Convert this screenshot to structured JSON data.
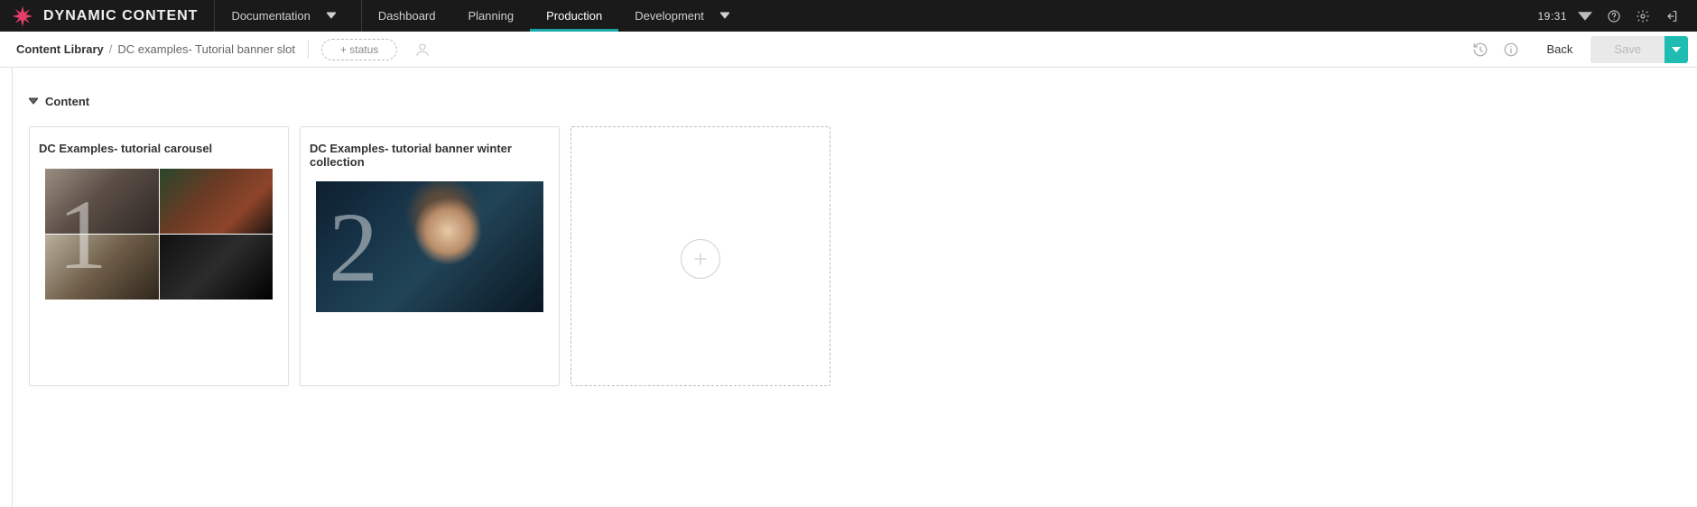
{
  "brand": {
    "name": "DYNAMIC CONTENT"
  },
  "nav": {
    "documentation": "Documentation",
    "items": [
      {
        "label": "Dashboard"
      },
      {
        "label": "Planning"
      },
      {
        "label": "Production"
      },
      {
        "label": "Development"
      }
    ],
    "active_index": 2
  },
  "header": {
    "clock": "19:31"
  },
  "breadcrumb": {
    "root": "Content Library",
    "separator": "/",
    "current": "DC examples- Tutorial banner slot"
  },
  "toolbar": {
    "status_label": "+ status",
    "back_label": "Back",
    "save_label": "Save"
  },
  "section": {
    "title": "Content",
    "cards": [
      {
        "title": "DC Examples- tutorial carousel",
        "watermark": "1",
        "kind": "carousel"
      },
      {
        "title": "DC Examples- tutorial banner winter collection",
        "watermark": "2",
        "kind": "banner"
      }
    ]
  }
}
